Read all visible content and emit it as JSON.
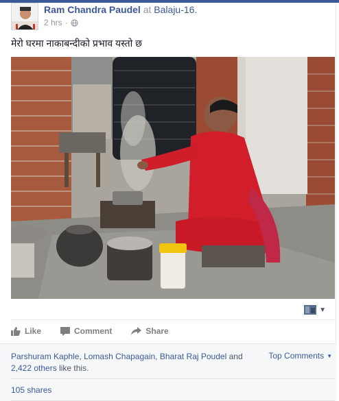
{
  "post": {
    "author": "Ram Chandra Paudel",
    "at_word": "at",
    "location": "Balaju-16.",
    "time": "2 hrs",
    "dot": "·",
    "text": "मेरो घरमा नाकाबन्दीको प्रभाव यस्तो छ"
  },
  "actions": {
    "like": "Like",
    "comment": "Comment",
    "share": "Share"
  },
  "likes": {
    "name1": "Parshuram Kaphle",
    "comma1": ",",
    "name2": "Lomash Chapagain",
    "comma2": ",",
    "name3": "Bharat Raj Poudel",
    "and_word": "and",
    "others": "2,422 others",
    "suffix": "like this."
  },
  "top_comments": "Top Comments",
  "shares": "105 shares",
  "colors": {
    "brand": "#3b5998",
    "muted": "#9197a3",
    "likes_bg": "#f6f7f9"
  }
}
